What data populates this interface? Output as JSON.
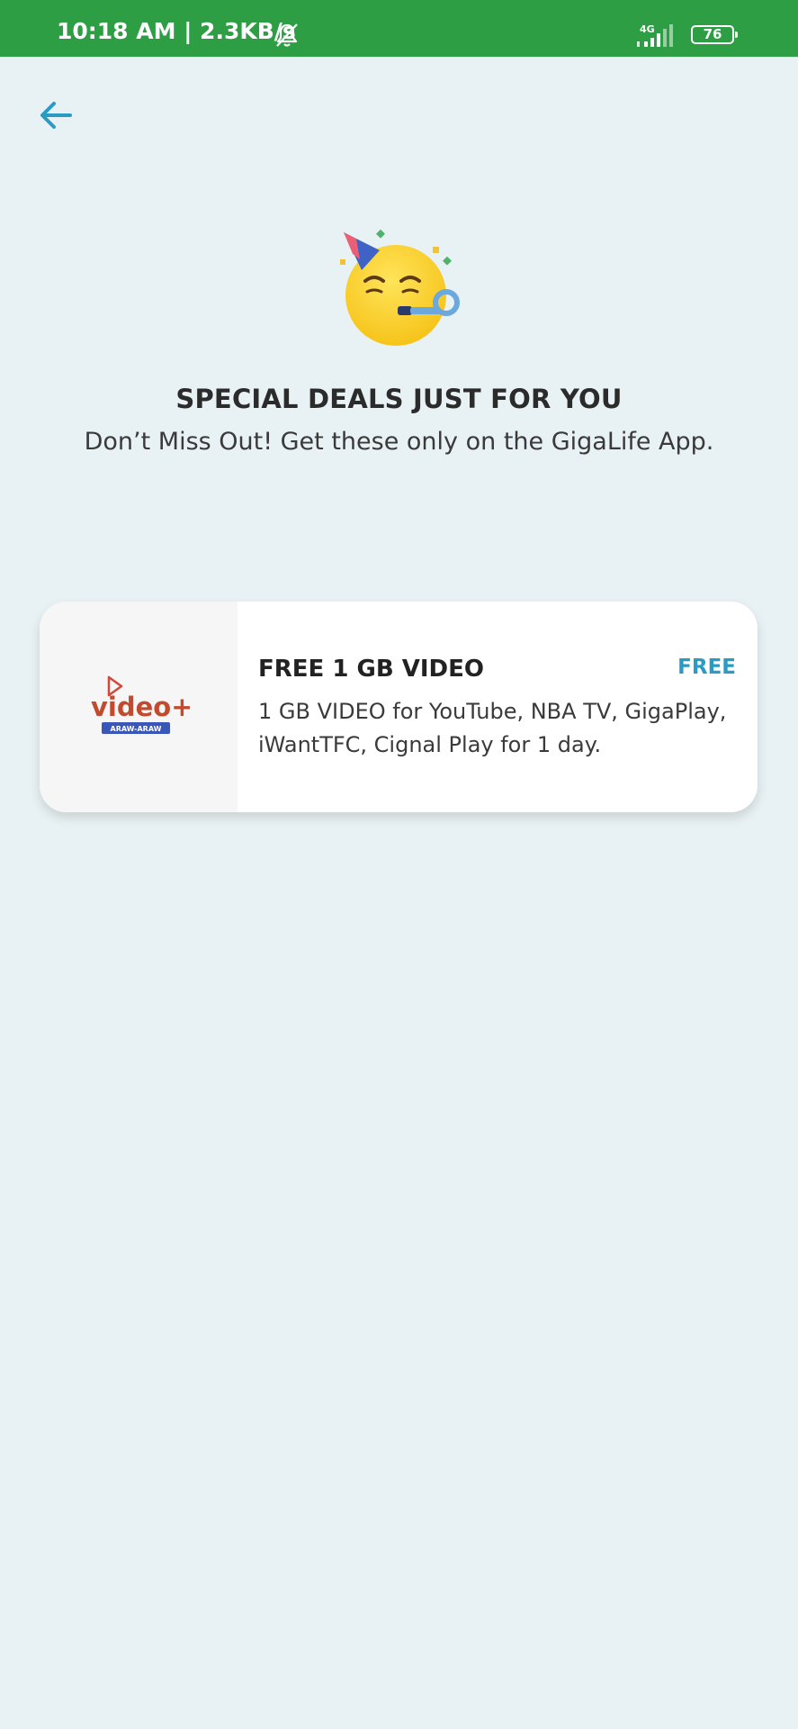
{
  "status_bar": {
    "time": "10:18 AM | 2.3KB/s",
    "network": "4G",
    "battery": "76",
    "icons": [
      "bell-off-icon",
      "signal-icon",
      "battery-icon"
    ]
  },
  "nav": {
    "back_icon": "arrow-left-icon"
  },
  "hero": {
    "icon": "party-face-emoji",
    "title": "SPECIAL DEALS JUST FOR YOU",
    "subtitle": "Don’t Miss Out! Get these only on the GigaLife App."
  },
  "deals": [
    {
      "logo_icon": "video-plus-logo",
      "logo_text": "video+",
      "logo_tag": "ARAW-ARAW",
      "title": "FREE 1 GB VIDEO",
      "price": "FREE",
      "description": "1 GB VIDEO for YouTube, NBA TV, GigaPlay, iWantTFC, Cignal Play for 1 day."
    }
  ],
  "colors": {
    "status_bar": "#2e9e45",
    "background": "#e8f1f3",
    "accent": "#2a9bc5",
    "card": "#ffffff"
  }
}
